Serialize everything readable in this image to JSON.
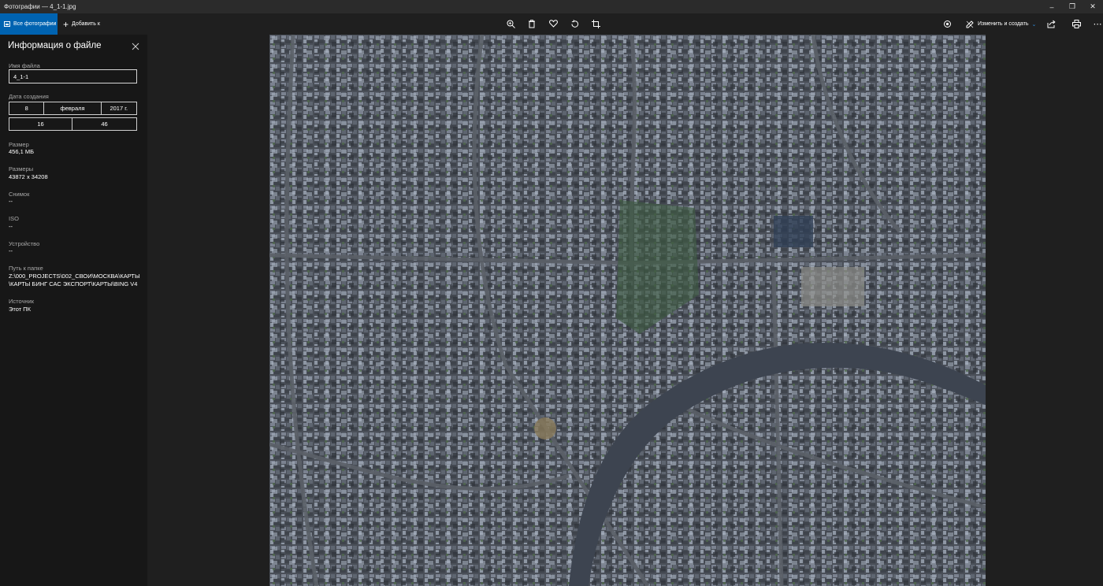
{
  "window": {
    "title": "Фотографии — 4_1-1.jpg",
    "minimize": "–",
    "maximize": "❐",
    "close": "✕"
  },
  "toolbar": {
    "all_photos": "Все фотографии",
    "add_to": "Добавить к",
    "edit_create": "Изменить и создать",
    "icons": [
      "zoom-icon",
      "delete-icon",
      "favorite-icon",
      "rotate-icon",
      "crop-icon",
      "slideshow-icon",
      "share-icon",
      "print-icon",
      "more-icon"
    ]
  },
  "panel": {
    "title": "Информация о файле",
    "filename_label": "Имя файла",
    "filename_value": "4_1-1",
    "date_label": "Дата создания",
    "date_day": "8",
    "date_month": "февраля",
    "date_year": "2017 г.",
    "time_hour": "16",
    "time_minute": "46",
    "size_label": "Размер",
    "size_value": "456,1 МБ",
    "dimensions_label": "Размеры",
    "dimensions_value": "43872 x 34208",
    "shot_label": "Снимок",
    "shot_value": "--",
    "iso_label": "ISO",
    "iso_value": "--",
    "device_label": "Устройство",
    "device_value": "--",
    "path_label": "Путь к папке",
    "path_line1": "Z:\\000_PROJECTS\\002_СВОИ\\МОСКВА\\КАРТЫ",
    "path_line2": "\\КАРТЫ БИНГ САС ЭКСПОРТ\\КАРТЫ\\BING V4",
    "source_label": "Источник",
    "source_value": "Этот ПК"
  },
  "colors": {
    "accent": "#0063b1",
    "panel_bg": "#171717",
    "app_bg": "#1f1f1f",
    "river": "#3d4450"
  }
}
